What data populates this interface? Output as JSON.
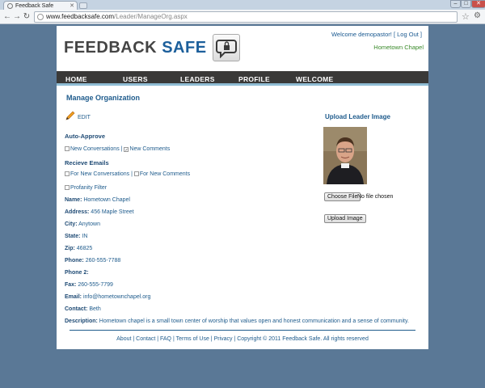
{
  "browser": {
    "tab_title": "Feedback Safe",
    "url_host": "www.feedbacksafe.com",
    "url_path": "/Leader/ManageOrg.aspx"
  },
  "header": {
    "logo_feedback": "FEEDBACK",
    "logo_safe": "SAFE",
    "welcome_prefix": "Welcome demopastor!",
    "logout": "Log Out",
    "church": "Hometown Chapel"
  },
  "nav": [
    "HOME",
    "USERS",
    "LEADERS",
    "PROFILE",
    "WELCOME"
  ],
  "main": {
    "title": "Manage Organization",
    "edit": "EDIT",
    "auto_approve": {
      "heading": "Auto-Approve",
      "opt1": "New Conversations",
      "opt2": "New Comments",
      "opt1_checked": false,
      "opt2_checked": true
    },
    "receive_emails": {
      "heading": "Recieve Emails",
      "opt1": "For New Conversations",
      "opt2": "For New Comments",
      "opt3": "Profanity Filter"
    },
    "fields": {
      "name_label": "Name:",
      "name": "Hometown Chapel",
      "address_label": "Address:",
      "address": "456 Maple Street",
      "city_label": "City:",
      "city": "Anytown",
      "state_label": "State:",
      "state": "IN",
      "zip_label": "Zip:",
      "zip": "46825",
      "phone_label": "Phone:",
      "phone": "260-555-7788",
      "phone2_label": "Phone 2:",
      "phone2": "",
      "fax_label": "Fax:",
      "fax": "260-555-7799",
      "email_label": "Email:",
      "email": "info@hometownchapel.org",
      "contact_label": "Contact:",
      "contact": "Beth",
      "description_label": "Description:",
      "description": "Hometown chapel is a small town center of worship that values open and honest communication and a sense of community."
    }
  },
  "upload": {
    "title": "Upload Leader Image",
    "choose_file": "Choose File",
    "file_status": "No file chosen",
    "upload_button": "Upload Image"
  },
  "footer": {
    "about": "About",
    "contact": "Contact",
    "faq": "FAQ",
    "terms": "Terms of Use",
    "privacy": "Privacy",
    "copyright": "Copyright © 2011 Feedback Safe. All rights reserved"
  }
}
